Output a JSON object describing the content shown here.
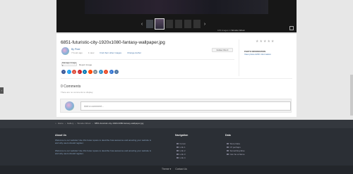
{
  "gallery": {
    "caption_prefix": "109 images in",
    "caption_album": "Wonder Album"
  },
  "image": {
    "title": "6851-futuristic-city-1920x1080-fantasy-wallpaper.jpg",
    "author": "By Pixer",
    "posted": "7 hours ago",
    "views": "1 view",
    "find_other": "Find their other images",
    "change_author": "Change Author",
    "follow_label": "Follow this",
    "follow_count": "0"
  },
  "sidebar": {
    "info_title": "PHOTO INFORMATION",
    "info_link": "View photo EXIF information"
  },
  "actions": {
    "manage_label": "Manage Image ▾",
    "report_label": "Report Image"
  },
  "share": [
    {
      "icon": "facebook-icon",
      "glyph": "f",
      "color": "#3b5998"
    },
    {
      "icon": "twitter-icon",
      "glyph": "t",
      "color": "#1da1f2"
    },
    {
      "icon": "google-plus-icon",
      "glyph": "g",
      "color": "#dd4b39"
    },
    {
      "icon": "pinterest-icon",
      "glyph": "p",
      "color": "#cb2027"
    },
    {
      "icon": "linkedin-icon",
      "glyph": "in",
      "color": "#0077b5"
    },
    {
      "icon": "reddit-icon",
      "glyph": "r",
      "color": "#ff4500"
    },
    {
      "icon": "email-icon",
      "glyph": "@",
      "color": "#7a8791"
    },
    {
      "icon": "digg-icon",
      "glyph": "d",
      "color": "#2f8fca"
    },
    {
      "icon": "stumble-icon",
      "glyph": "s",
      "color": "#eb4924"
    },
    {
      "icon": "delicious-icon",
      "glyph": "d",
      "color": "#3274d1"
    },
    {
      "icon": "vk-icon",
      "glyph": "v",
      "color": "#4c75a3"
    }
  ],
  "comments": {
    "heading": "0 Comments",
    "empty": "There are no comments to display.",
    "placeholder": "Add a comment..."
  },
  "breadcrumb": [
    "Home",
    "Gallery",
    "Wonder Album",
    "6851-futuristic-city-1920x1080-fantasy-wallpaper.jpg"
  ],
  "footer": {
    "about_title": "About Us",
    "about_text_1": "Welcome to our website! Use this footer space to describe how awesome and amazing your website is and why users should register.",
    "about_text_2": "Welcome to our website! Use this footer space to describe how awesome and amazing your website is and why users should register.",
    "nav_title": "Navigation",
    "nav_links": [
      "Forum",
      "Link 1",
      "Link 2",
      "Link 3",
      "Link 4"
    ],
    "data_title": "Data",
    "data_links": [
      "Store Data",
      "Ol&rsquo; perhaps",
      "Something Else",
      "Can be a Name"
    ]
  },
  "bottom": {
    "theme": "Theme ▾",
    "contact": "Contact Us"
  },
  "colors": {
    "accent": "#3a6ea5",
    "footer_bg": "#2b2f35"
  }
}
